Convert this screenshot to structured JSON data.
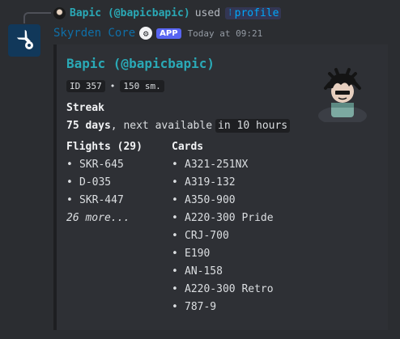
{
  "reply": {
    "user_name": "Bapic (@bapicbapic)",
    "used_text": "used",
    "command": "profile",
    "command_icon": "slash-command-icon"
  },
  "message": {
    "bot_name": "Skyrden Core",
    "app_tag": "APP",
    "timestamp": "Today at 09:21",
    "avatar_icon": "plane-gear-icon"
  },
  "embed": {
    "title": "Bapic (@bapicbapic)",
    "id_badge": "ID 357",
    "separator": "•",
    "score_badge": "150 sm.",
    "streak_label": "Streak",
    "streak_days": "75 days",
    "streak_next": ", next available",
    "streak_when": "in 10 hours",
    "flights": {
      "heading": "Flights (29)",
      "items": [
        "SKR-645",
        "D-035",
        "SKR-447"
      ],
      "more": "26 more..."
    },
    "cards": {
      "heading": "Cards",
      "items": [
        "A321-251NX",
        "A319-132",
        "A350-900",
        "A220-300 Pride",
        "CRJ-700",
        "E190",
        "AN-158",
        "A220-300 Retro",
        "787-9"
      ]
    },
    "bullet": "•"
  },
  "colors": {
    "background": "#2b2d31",
    "accent": "#2aa9b6",
    "bot_name": "#0f6fa8",
    "app_tag": "#5865f2"
  }
}
